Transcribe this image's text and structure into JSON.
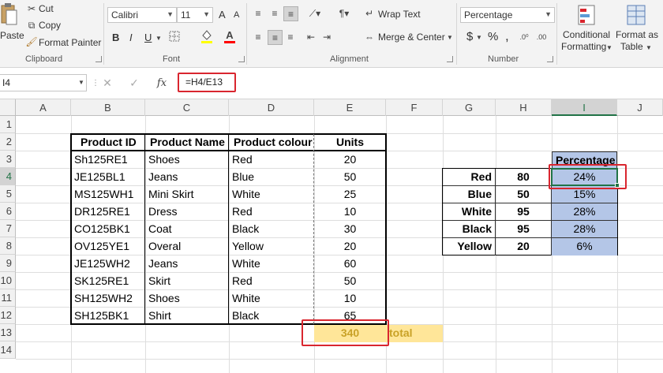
{
  "ribbon": {
    "clipboard": {
      "label": "Clipboard",
      "paste": "Paste",
      "cut": "Cut",
      "copy": "Copy",
      "format_painter": "Format Painter"
    },
    "font": {
      "label": "Font",
      "family": "Calibri",
      "size": "11",
      "bold": "B",
      "italic": "I",
      "underline": "U",
      "grow": "A",
      "shrink": "A",
      "font_color": "A",
      "font_color_hex": "#ff0000",
      "fill_color_hex": "#ffff00"
    },
    "alignment": {
      "label": "Alignment",
      "wrap_text": "Wrap Text",
      "merge_center": "Merge & Center"
    },
    "number": {
      "label": "Number",
      "format": "Percentage",
      "currency": "$",
      "percent": "%",
      "comma": ","
    },
    "styles": {
      "conditional_formatting_1": "Conditional",
      "conditional_formatting_2": "Formatting",
      "format_as_table_1": "Format as",
      "format_as_table_2": "Table"
    }
  },
  "formula_bar": {
    "name_box": "I4",
    "formula": "=H4/E13",
    "cancel": "✕",
    "enter": "✓",
    "fx": "fx"
  },
  "columns": [
    "A",
    "B",
    "C",
    "D",
    "E",
    "F",
    "G",
    "H",
    "I",
    "J"
  ],
  "rows": [
    "1",
    "2",
    "3",
    "4",
    "5",
    "6",
    "7",
    "8",
    "9",
    "10",
    "11",
    "12",
    "13",
    "14"
  ],
  "selected": {
    "column": "I",
    "row": "4"
  },
  "product_table": {
    "headers": [
      "Product ID",
      "Product Name",
      "Product colour",
      "Units"
    ],
    "rows": [
      [
        "Sh125RE1",
        "Shoes",
        "Red",
        "20"
      ],
      [
        "JE125BL1",
        "Jeans",
        "Blue",
        "50"
      ],
      [
        "MS125WH1",
        "Mini Skirt",
        "White",
        "25"
      ],
      [
        "DR125RE1",
        "Dress",
        "Red",
        "10"
      ],
      [
        "CO125BK1",
        "Coat",
        "Black",
        "30"
      ],
      [
        "OV125YE1",
        "Overal",
        "Yellow",
        "20"
      ],
      [
        "JE125WH2",
        "Jeans",
        "White",
        "60"
      ],
      [
        "SK125RE1",
        "Skirt",
        "Red",
        "50"
      ],
      [
        "SH125WH2",
        "Shoes",
        "White",
        "10"
      ],
      [
        "SH125BK1",
        "Shirt",
        "Black",
        "65"
      ]
    ]
  },
  "total": {
    "value": "340",
    "label": "total"
  },
  "summary_table": {
    "header": "Percentage",
    "rows": [
      [
        "Red",
        "80",
        "24%"
      ],
      [
        "Blue",
        "50",
        "15%"
      ],
      [
        "White",
        "95",
        "28%"
      ],
      [
        "Black",
        "95",
        "28%"
      ],
      [
        "Yellow",
        "20",
        "6%"
      ]
    ]
  },
  "colors": {
    "highlight_red": "#d9262f",
    "percent_fill": "#b4c6e7",
    "total_fill": "#ffe699",
    "total_text": "#c9a227",
    "excel_green": "#217346"
  }
}
